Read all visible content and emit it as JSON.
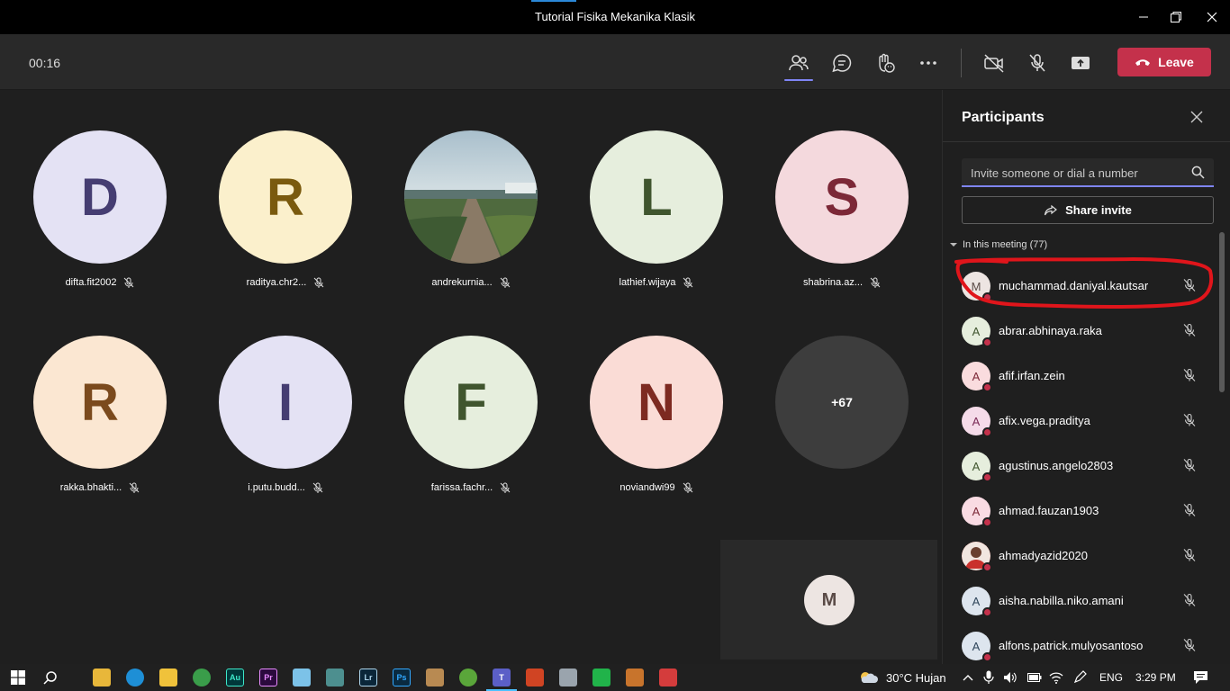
{
  "window": {
    "title": "Tutorial Fisika Mekanika Klasik"
  },
  "toolbar": {
    "timer": "00:16",
    "leave_label": "Leave"
  },
  "tiles": [
    {
      "name": "difta.fit2002",
      "initial": "D",
      "bg": "#e4e2f4",
      "fg": "#453d72"
    },
    {
      "name": "raditya.chr2...",
      "initial": "R",
      "bg": "#fbf0cc",
      "fg": "#7a5a0e"
    },
    {
      "name": "andrekurnia...",
      "initial": "",
      "bg": "#6d8894",
      "fg": "#ffffff"
    },
    {
      "name": "lathief.wijaya",
      "initial": "L",
      "bg": "#e6eedd",
      "fg": "#40552e"
    },
    {
      "name": "shabrina.az...",
      "initial": "S",
      "bg": "#f4d9dd",
      "fg": "#7c2837"
    },
    {
      "name": "rakka.bhakti...",
      "initial": "R",
      "bg": "#fbe7d2",
      "fg": "#7b4a1d"
    },
    {
      "name": "i.putu.budd...",
      "initial": "I",
      "bg": "#e4e2f4",
      "fg": "#453d72"
    },
    {
      "name": "farissa.fachr...",
      "initial": "F",
      "bg": "#e6eedd",
      "fg": "#40552e"
    },
    {
      "name": "noviandwi99",
      "initial": "N",
      "bg": "#fadcd6",
      "fg": "#7d2a21"
    }
  ],
  "overflow": {
    "label": "+67"
  },
  "self_view": {
    "initial": "M"
  },
  "panel": {
    "title": "Participants",
    "invite_placeholder": "Invite someone or dial a number",
    "share_label": "Share invite",
    "section_label": "In this meeting (77)",
    "participants": [
      {
        "name": "muchammad.daniyal.kautsar",
        "initial": "M",
        "bg": "#ede5e2",
        "fg": "#5a4a46"
      },
      {
        "name": "abrar.abhinaya.raka",
        "initial": "A",
        "bg": "#e6eedd",
        "fg": "#40552e"
      },
      {
        "name": "afif.irfan.zein",
        "initial": "A",
        "bg": "#fadcde",
        "fg": "#7c2837"
      },
      {
        "name": "afix.vega.praditya",
        "initial": "A",
        "bg": "#f5dbe9",
        "fg": "#7a2a56"
      },
      {
        "name": "agustinus.angelo2803",
        "initial": "A",
        "bg": "#e6eedd",
        "fg": "#40552e"
      },
      {
        "name": "ahmad.fauzan1903",
        "initial": "A",
        "bg": "#f9dbe3",
        "fg": "#7c2837"
      },
      {
        "name": "ahmadyazid2020",
        "initial": "",
        "bg": "#c9463f",
        "fg": "#ffffff"
      },
      {
        "name": "aisha.nabilla.niko.amani",
        "initial": "A",
        "bg": "#dde5ee",
        "fg": "#2e455a"
      },
      {
        "name": "alfons.patrick.mulyosantoso",
        "initial": "A",
        "bg": "#dde5ee",
        "fg": "#2e455a"
      }
    ]
  },
  "taskbar": {
    "weather": "30°C  Hujan",
    "lang": "ENG",
    "time": "3:29 PM",
    "apps": [
      {
        "label": "",
        "color": "#e8b73a"
      },
      {
        "label": "",
        "color": "#1e8fd6"
      },
      {
        "label": "",
        "color": "#f0c23b"
      },
      {
        "label": "",
        "color": "#3a9d4a"
      },
      {
        "label": "Au",
        "color": "#00383a"
      },
      {
        "label": "Pr",
        "color": "#2b0a3d"
      },
      {
        "label": "",
        "color": "#7cc2e8"
      },
      {
        "label": "",
        "color": "#4d8f8f"
      },
      {
        "label": "Lr",
        "color": "#0a2639"
      },
      {
        "label": "Ps",
        "color": "#0a2a40"
      },
      {
        "label": "",
        "color": "#b88a52"
      },
      {
        "label": "",
        "color": "#5aa63a"
      },
      {
        "label": "T",
        "color": "#5b5fc7"
      },
      {
        "label": "",
        "color": "#d04423"
      },
      {
        "label": "",
        "color": "#9aa4ad"
      },
      {
        "label": "",
        "color": "#21b34a"
      },
      {
        "label": "",
        "color": "#c8742c"
      },
      {
        "label": "",
        "color": "#d43c3c"
      }
    ]
  }
}
